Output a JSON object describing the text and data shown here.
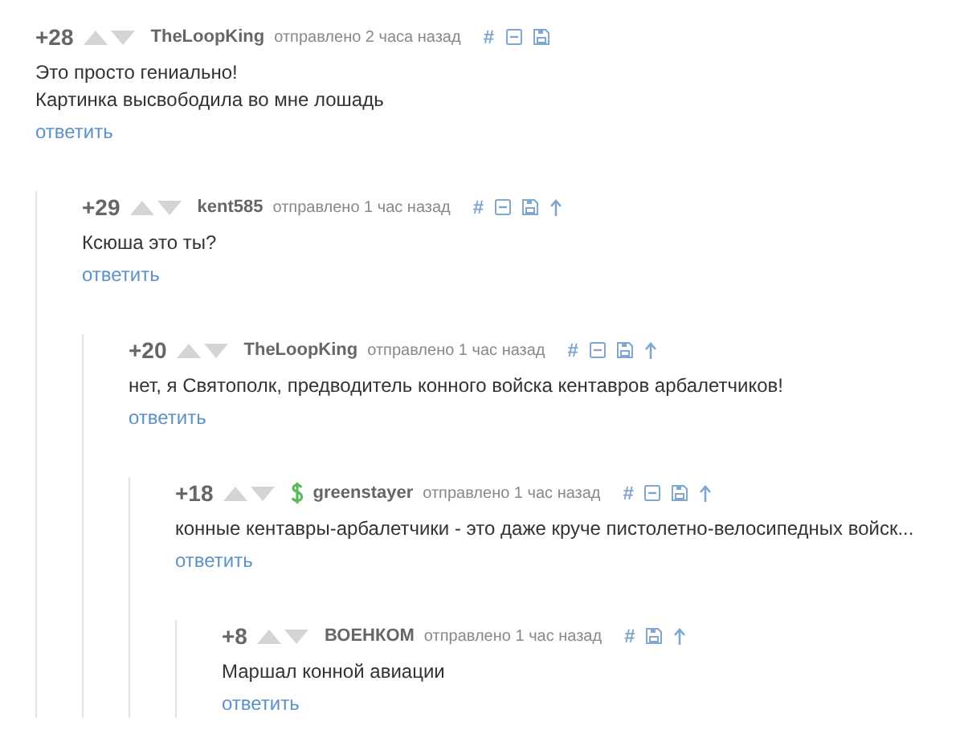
{
  "comments": [
    {
      "rating": "+28",
      "author": "TheLoopKing",
      "donor": false,
      "time": "отправлено 2 часа назад",
      "tools": [
        {
          "kind": "anchor",
          "label": "#"
        },
        {
          "kind": "collapse"
        },
        {
          "kind": "save"
        }
      ],
      "text": [
        "Это просто гениально!",
        "Картинка высвободила во мне лошадь"
      ],
      "reply": "ответить",
      "children": [
        {
          "rating": "+29",
          "author": "kent585",
          "donor": false,
          "time": "отправлено 1 час назад",
          "tools": [
            {
              "kind": "anchor",
              "label": "#"
            },
            {
              "kind": "collapse"
            },
            {
              "kind": "save"
            },
            {
              "kind": "parent"
            }
          ],
          "text": [
            "Ксюша это ты?"
          ],
          "reply": "ответить",
          "children": [
            {
              "rating": "+20",
              "author": "TheLoopKing",
              "donor": false,
              "time": "отправлено 1 час назад",
              "tools": [
                {
                  "kind": "anchor",
                  "label": "#"
                },
                {
                  "kind": "collapse"
                },
                {
                  "kind": "save"
                },
                {
                  "kind": "parent"
                }
              ],
              "text": [
                "нет, я Святополк, предводитель конного войска кентавров арбалетчиков!"
              ],
              "reply": "ответить",
              "children": [
                {
                  "rating": "+18",
                  "author": "greenstayer",
                  "donor": true,
                  "time": "отправлено 1 час назад",
                  "tools": [
                    {
                      "kind": "anchor",
                      "label": "#"
                    },
                    {
                      "kind": "collapse"
                    },
                    {
                      "kind": "save"
                    },
                    {
                      "kind": "parent"
                    }
                  ],
                  "text": [
                    "конные кентавры-арбалетчики - это даже круче пистолетно-велосипедных войск..."
                  ],
                  "reply": "ответить",
                  "children": [
                    {
                      "rating": "+8",
                      "author": "ВОЕНКОМ",
                      "donor": false,
                      "time": "отправлено 1 час назад",
                      "tools": [
                        {
                          "kind": "anchor",
                          "label": "#"
                        },
                        {
                          "kind": "save"
                        },
                        {
                          "kind": "parent"
                        }
                      ],
                      "text": [
                        "Маршал конной авиации"
                      ],
                      "reply": "ответить"
                    }
                  ]
                }
              ]
            }
          ]
        }
      ]
    }
  ]
}
